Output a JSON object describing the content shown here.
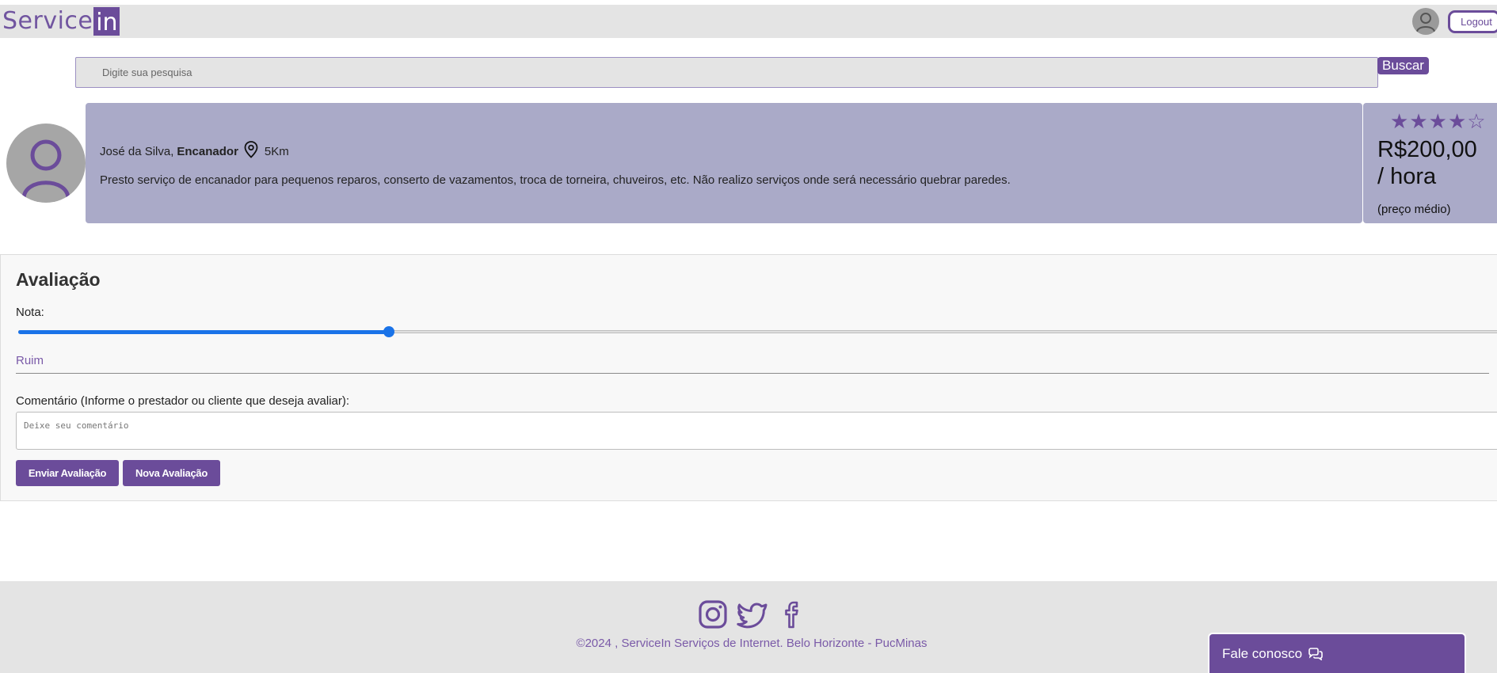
{
  "header": {
    "logo_text": "Service",
    "logo_box": "in",
    "logout_label": "Logout"
  },
  "search": {
    "placeholder": "Digite sua pesquisa",
    "button_label": "Buscar"
  },
  "provider": {
    "name": "José da Silva,",
    "profession": "Encanador",
    "distance": "5Km",
    "description": "Presto serviço de encanador para pequenos reparos, conserto de vazamentos, troca de torneira, chuveiros, etc. Não realizo serviços onde será necessário quebrar paredes.",
    "rating_stars": 4,
    "rating_max": 5,
    "price_line1": "R$200,00",
    "price_line2": "/ hora",
    "price_note": "(preço médio)"
  },
  "evaluation": {
    "title": "Avaliação",
    "nota_label": "Nota:",
    "slider_value": 0.25,
    "rating_text": "Ruim",
    "comment_label": "Comentário (Informe o prestador ou cliente que deseja avaliar):",
    "comment_placeholder": "Deixe seu comentário",
    "send_label": "Enviar Avaliação",
    "new_label": "Nova Avaliação"
  },
  "footer": {
    "social_icons": [
      "instagram-icon",
      "twitter-icon",
      "facebook-icon"
    ],
    "copyright": "©2024 , ServiceIn Serviços de Internet. Belo Horizonte - PucMinas",
    "contact_label": "Fale conosco"
  },
  "colors": {
    "brand": "#6b4c9a",
    "card": "#aaaac8",
    "slider": "#1a73e8"
  }
}
